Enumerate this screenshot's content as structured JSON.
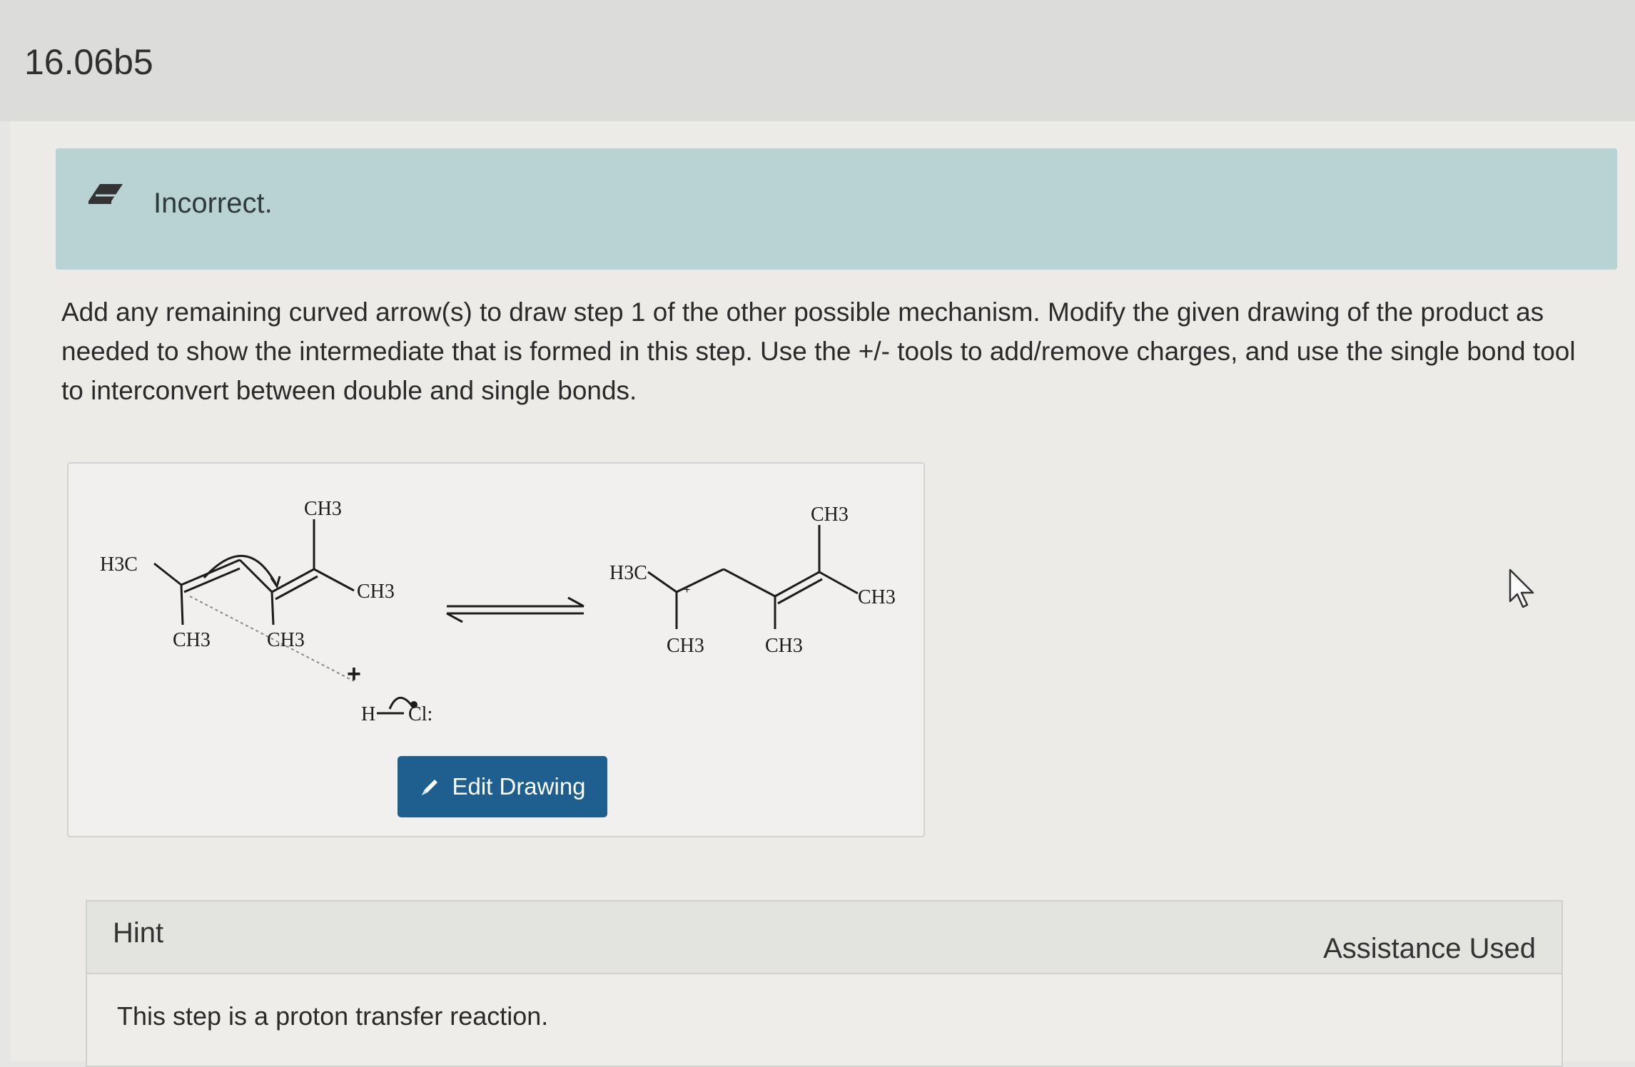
{
  "problem": {
    "id": "16.06b5"
  },
  "status": {
    "text": "Incorrect.",
    "icon": "eraser-icon"
  },
  "instructions": "Add any remaining curved arrow(s) to draw step 1 of the other possible mechanism. Modify the given drawing of the product as needed to show the intermediate that is formed in this step. Use the +/- tools to add/remove charges, and use the single bond tool to interconvert between double and single bonds.",
  "drawing": {
    "reactant_labels": {
      "h3c": "H3C",
      "ch3_top": "CH3",
      "ch3_right": "CH3",
      "ch3_bottom_left": "CH3",
      "ch3_bottom_mid": "CH3"
    },
    "plus_sign": "+",
    "reagent": {
      "h": "H",
      "cl": "Cl:"
    },
    "product_labels": {
      "h3c": "H3C",
      "ch3_top": "CH3",
      "ch3_right": "CH3",
      "ch3_bottom_left": "CH3",
      "ch3_bottom_mid": "CH3"
    },
    "edit_button_label": "Edit Drawing"
  },
  "hint": {
    "title": "Hint",
    "assistance": "Assistance Used",
    "text": "This step is a proton transfer reaction."
  }
}
